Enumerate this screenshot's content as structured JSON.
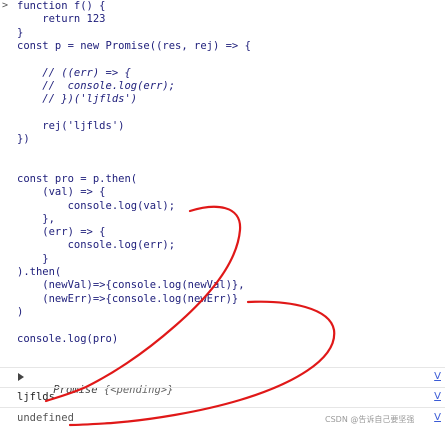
{
  "code_lines": [
    "function f() {",
    "    return 123",
    "}",
    "const p = new Promise((res, rej) => {",
    "",
    "    // ((err) => {",
    "    //  console.log(err);",
    "    // })('ljflds')",
    "",
    "    rej('ljflds')",
    "})",
    "",
    "",
    "const pro = p.then(",
    "    (val) => {",
    "        console.log(val);",
    "    },",
    "    (err) => {",
    "        console.log(err);",
    "    }",
    ").then(",
    "    (newVal)=>{console.log(newVal)},",
    "    (newErr)=>{console.log(newErr)}",
    ")",
    "",
    "console.log(pro)"
  ],
  "outputs": {
    "promise_label": "Promise",
    "promise_state": "{<pending>}",
    "log_value": "ljflds",
    "return_value": "undefined",
    "source_link": "V"
  },
  "watermark": "CSDN @告诉自己要坚强",
  "colors": {
    "scribble": "#e01818",
    "code_text": "#1d1d7a"
  }
}
